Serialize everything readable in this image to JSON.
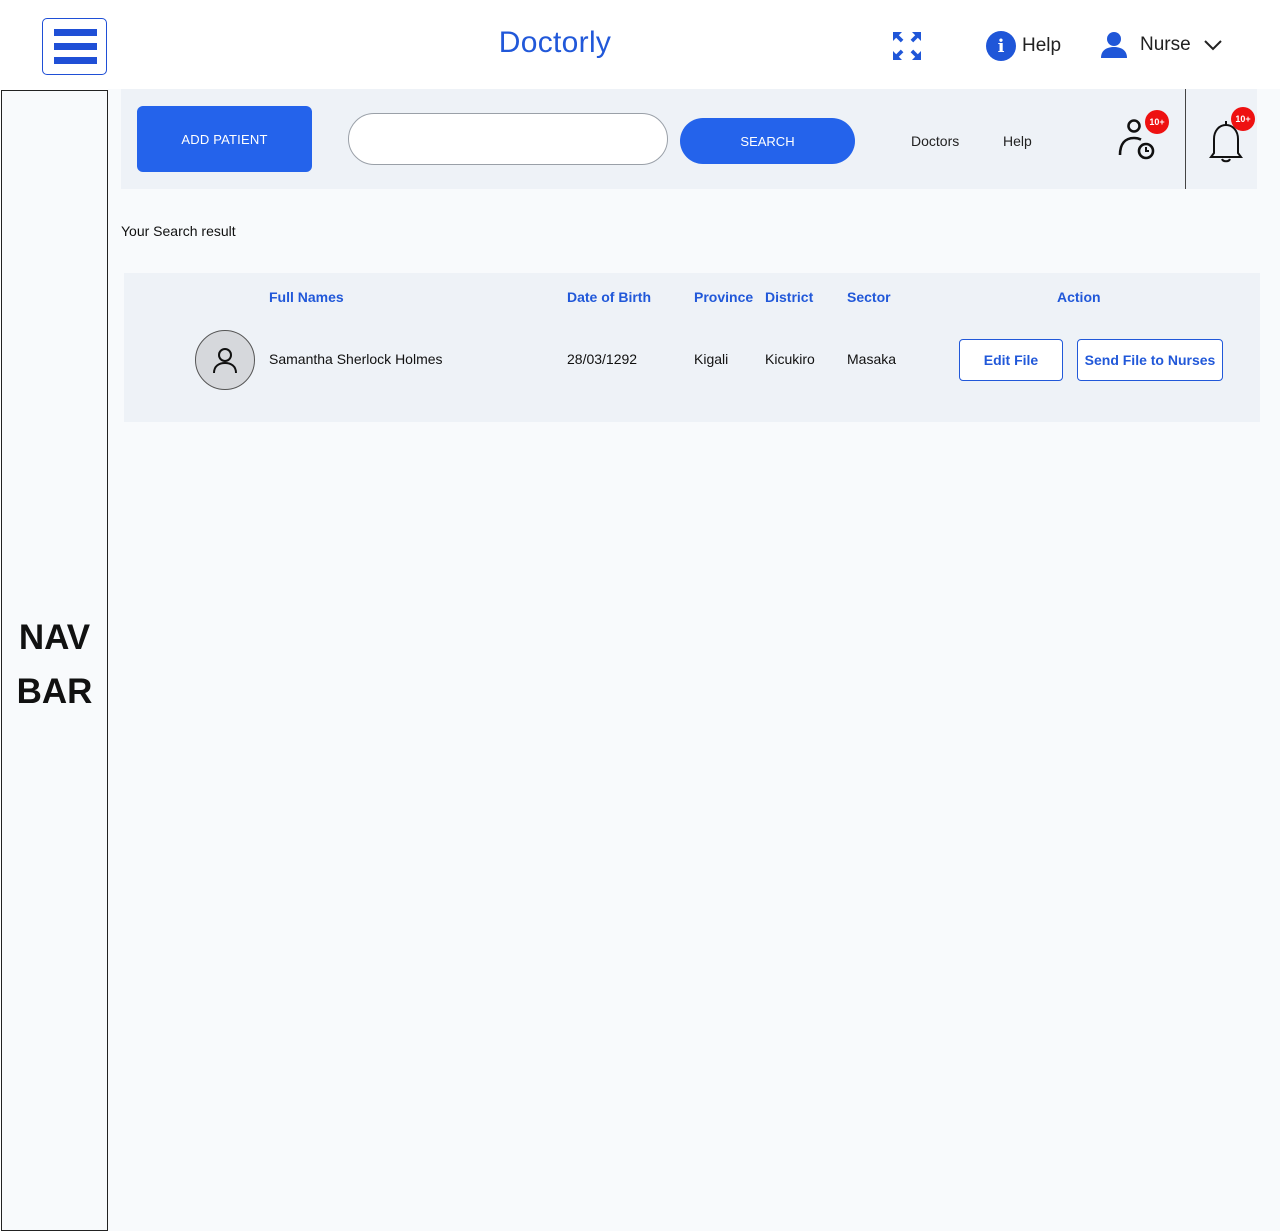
{
  "header": {
    "brand": "Doctorly",
    "help_label": "Help",
    "user_label": "Nurse",
    "brand_color": "#2158d9",
    "icons": [
      "menu-icon",
      "expand-icon",
      "info-icon",
      "user-icon",
      "chevron-down-icon"
    ]
  },
  "sidebar": {
    "line1": "NAV",
    "line2": "BAR"
  },
  "toolbar": {
    "add_patient_label": "ADD PATIENT",
    "search_placeholder": "",
    "search_value": "",
    "search_label": "SEARCH",
    "links": [
      "Doctors",
      "Help"
    ],
    "pending_badge": "10+",
    "notifications_badge": "10+",
    "accent_color": "#2463eb",
    "badge_color": "#ee1111"
  },
  "results": {
    "title": "Your Search result",
    "columns": [
      "Full Names",
      "Date of Birth",
      "Province",
      "District",
      "Sector",
      "Action"
    ],
    "rows": [
      {
        "full_name": "Samantha Sherlock  Holmes",
        "date_of_birth": "28/03/1292",
        "province": "Kigali",
        "district": "Kicukiro",
        "sector": "Masaka",
        "actions": [
          "Edit File",
          "Send File to Nurses"
        ]
      }
    ]
  }
}
